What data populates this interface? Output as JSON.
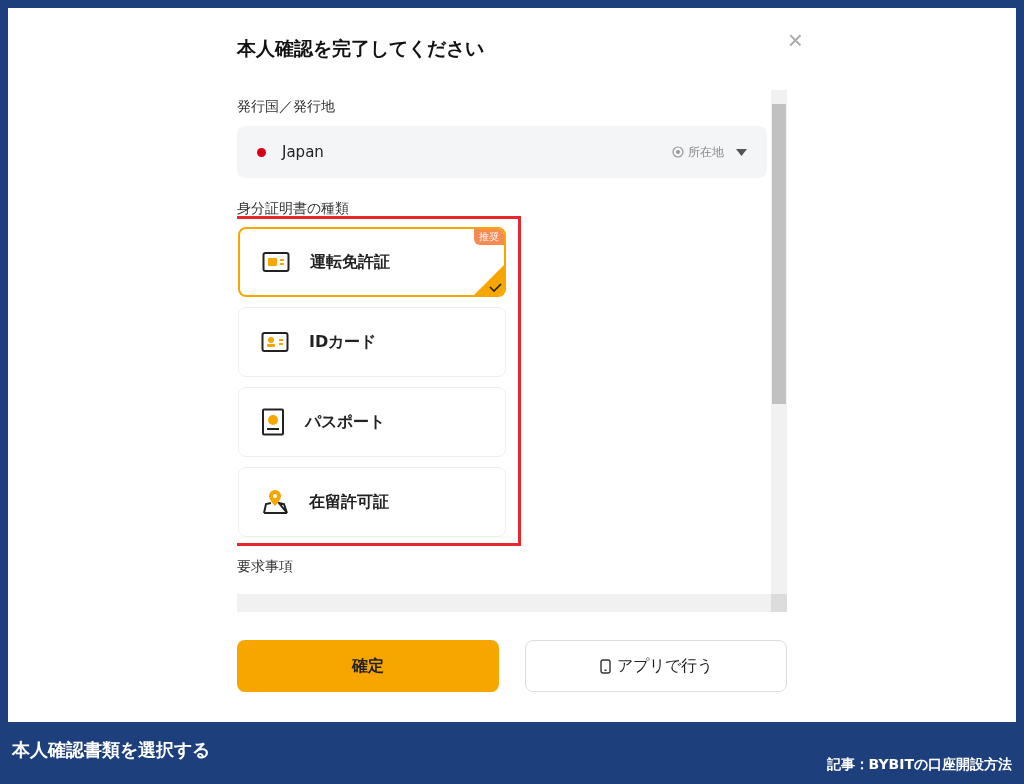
{
  "dialog": {
    "title": "本人確認を完了してください",
    "close": "×"
  },
  "issuer": {
    "label": "発行国／発行地",
    "country": "Japan",
    "location": "所在地"
  },
  "document_types": {
    "label": "身分証明書の種類",
    "items": [
      {
        "kind": "license",
        "label": "運転免許証",
        "selected": true,
        "badge": "推奨"
      },
      {
        "kind": "idcard",
        "label": "IDカード",
        "selected": false
      },
      {
        "kind": "passport",
        "label": "パスポート",
        "selected": false
      },
      {
        "kind": "residence",
        "label": "在留許可証",
        "selected": false
      }
    ]
  },
  "requirements": {
    "label": "要求事項"
  },
  "buttons": [
    {
      "kind": "primary",
      "label": "確定"
    },
    {
      "kind": "app",
      "label": "アプリで行う"
    }
  ],
  "footer": {
    "caption": "本人確認書類を選択する",
    "source": "記事：BYBITの口座開設方法"
  }
}
